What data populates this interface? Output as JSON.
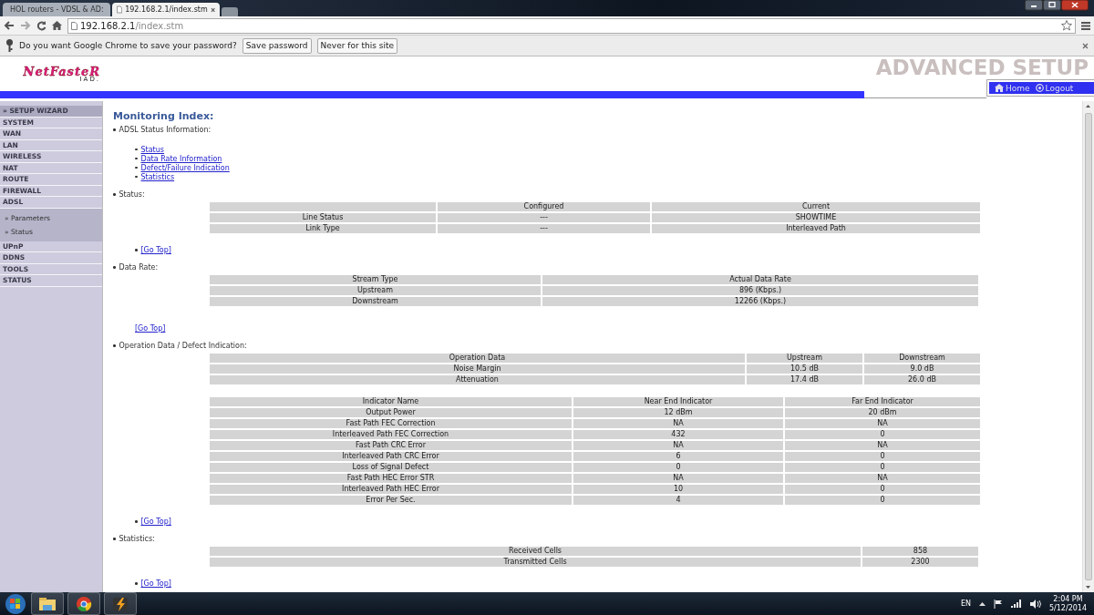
{
  "browser": {
    "tabs": [
      {
        "title": "HOL routers - VDSL & AD:",
        "selected": false
      },
      {
        "title": "192.168.2.1/index.stm",
        "selected": true
      }
    ],
    "address": {
      "host": "192.168.2.1",
      "path": "/index.stm"
    },
    "password_bar": {
      "message": "Do you want Google Chrome to save your password?",
      "buttons": [
        "Save password",
        "Never for this site"
      ]
    }
  },
  "header": {
    "logo": "NetFasteR",
    "logo_sub": "IAD.",
    "banner": "ADVANCED SETUP",
    "nav": [
      "Home",
      "Logout"
    ]
  },
  "sidebar": {
    "items": [
      {
        "label": "» SETUP WIZARD",
        "kind": "wizard"
      },
      {
        "label": "SYSTEM",
        "kind": "section"
      },
      {
        "label": "WAN",
        "kind": "section"
      },
      {
        "label": "LAN",
        "kind": "section"
      },
      {
        "label": "WIRELESS",
        "kind": "section"
      },
      {
        "label": "NAT",
        "kind": "section"
      },
      {
        "label": "ROUTE",
        "kind": "section"
      },
      {
        "label": "FIREWALL",
        "kind": "section"
      },
      {
        "label": "ADSL",
        "kind": "section",
        "expanded": true,
        "children": [
          {
            "label": "» Parameters"
          },
          {
            "label": "» Status"
          }
        ]
      },
      {
        "label": "UPnP",
        "kind": "section"
      },
      {
        "label": "DDNS",
        "kind": "section"
      },
      {
        "label": "TOOLS",
        "kind": "section"
      },
      {
        "label": "STATUS",
        "kind": "section"
      }
    ]
  },
  "content": {
    "title": "Monitoring Index:",
    "index": {
      "label": "ADSL Status Information:",
      "links": [
        "Status",
        "Data Rate Information",
        "Defect/Failure Indication",
        "Statistics"
      ]
    },
    "sections": [
      {
        "label": "Status:",
        "tables": [
          {
            "columns": [
              "",
              "Configured",
              "Current"
            ],
            "rows": [
              [
                "Line Status",
                "---",
                "SHOWTIME"
              ],
              [
                "Link Type",
                "---",
                "Interleaved Path"
              ]
            ]
          }
        ],
        "go_top": {
          "label": "[Go Top]",
          "bullet": true
        }
      },
      {
        "label": "Data Rate:",
        "tables": [
          {
            "columns": [
              "Stream Type",
              "Actual Data Rate"
            ],
            "rows": [
              [
                "Upstream",
                "896 (Kbps.)"
              ],
              [
                "Downstream",
                "12266 (Kbps.)"
              ]
            ]
          }
        ],
        "go_top": {
          "label": "[Go Top]",
          "bullet": false
        }
      },
      {
        "label": "Operation Data / Defect Indication:",
        "tables": [
          {
            "columns": [
              "Operation Data",
              "Upstream",
              "Downstream"
            ],
            "rows": [
              [
                "Noise Margin",
                "10.5 dB",
                "9.0 dB"
              ],
              [
                "Attenuation",
                "17.4 dB",
                "26.0 dB"
              ]
            ]
          },
          {
            "columns": [
              "Indicator Name",
              "Near End Indicator",
              "Far End Indicator"
            ],
            "rows": [
              [
                "Output Power",
                "12 dBm",
                "20 dBm"
              ],
              [
                "Fast Path FEC Correction",
                "NA",
                "NA"
              ],
              [
                "Interleaved Path FEC Correction",
                "432",
                "0"
              ],
              [
                "Fast Path CRC Error",
                "NA",
                "NA"
              ],
              [
                "Interleaved Path CRC Error",
                "6",
                "0"
              ],
              [
                "Loss of Signal Defect",
                "0",
                "0"
              ],
              [
                "Fast Path HEC Error STR",
                "NA",
                "NA"
              ],
              [
                "Interleaved Path HEC Error",
                "10",
                "0"
              ],
              [
                "Error Per Sec.",
                "4",
                "0"
              ]
            ]
          }
        ],
        "go_top": {
          "label": "[Go Top]",
          "bullet": true
        }
      },
      {
        "label": "Statistics:",
        "tables": [
          {
            "rows": [
              [
                "Received Cells",
                "858"
              ],
              [
                "Transmitted Cells",
                "2300"
              ]
            ]
          }
        ],
        "go_top": {
          "label": "[Go Top]",
          "bullet": true
        }
      }
    ]
  },
  "taskbar": {
    "language": "EN",
    "time": "2:04 PM",
    "date": "5/12/2014"
  }
}
